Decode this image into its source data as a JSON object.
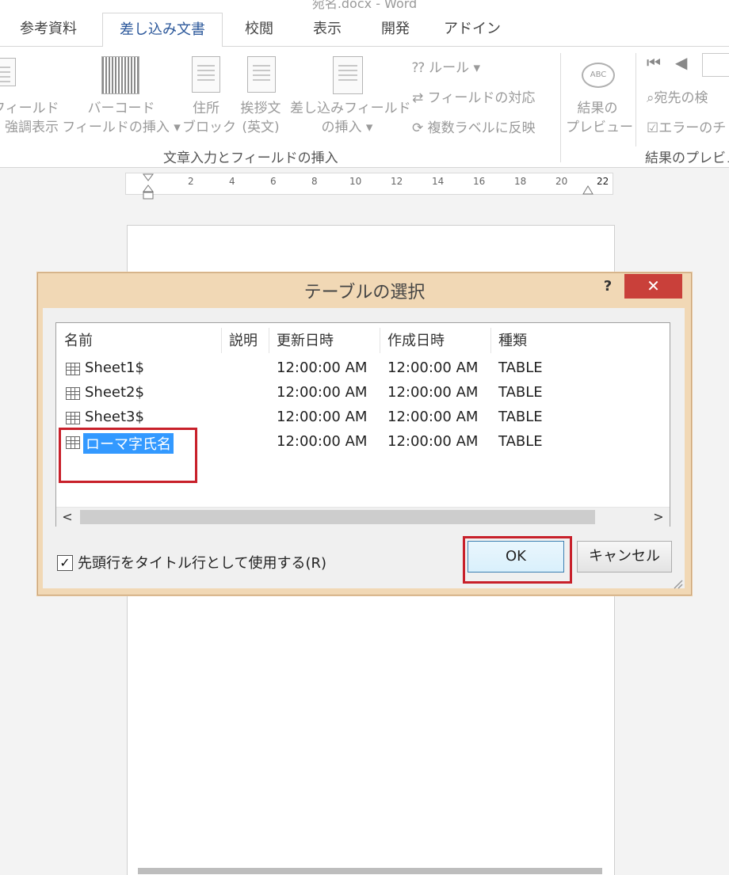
{
  "window": {
    "title": "宛名.docx - Word"
  },
  "tabs": [
    {
      "label": "参考資料"
    },
    {
      "label": "差し込み文書",
      "active": true
    },
    {
      "label": "校閲"
    },
    {
      "label": "表示"
    },
    {
      "label": "開発"
    },
    {
      "label": "アドイン"
    }
  ],
  "ribbon": {
    "field_highlight": [
      "フィールド",
      "強調表示"
    ],
    "barcode": [
      "バーコード",
      "フィールドの挿入"
    ],
    "address_block": [
      "住所",
      "ブロック"
    ],
    "greeting": [
      "挨拶文",
      "(英文)"
    ],
    "insert_merge_field": [
      "差し込みフィールド",
      "の挿入"
    ],
    "rules": "ルール",
    "match_fields": "フィールドの対応",
    "update_labels": "複数ラベルに反映",
    "group_write_insert": "文章入力とフィールドの挿入",
    "preview_results": [
      "結果の",
      "プレビュー"
    ],
    "find_recipient": "宛先の検",
    "check_errors": "エラーのチ",
    "group_preview": "結果のプレビュ"
  },
  "ruler": {
    "ticks": [
      "2",
      "4",
      "6",
      "8",
      "10",
      "12",
      "14",
      "16",
      "18",
      "20",
      "22"
    ]
  },
  "dialog": {
    "title": "テーブルの選択",
    "help_label": "?",
    "close_label": "✕",
    "columns": [
      "名前",
      "説明",
      "更新日時",
      "作成日時",
      "種類"
    ],
    "rows": [
      {
        "name": "Sheet1$",
        "description": "",
        "modified": "12:00:00 AM",
        "created": "12:00:00 AM",
        "type": "TABLE",
        "selected": false
      },
      {
        "name": "Sheet2$",
        "description": "",
        "modified": "12:00:00 AM",
        "created": "12:00:00 AM",
        "type": "TABLE",
        "selected": false
      },
      {
        "name": "Sheet3$",
        "description": "",
        "modified": "12:00:00 AM",
        "created": "12:00:00 AM",
        "type": "TABLE",
        "selected": false
      },
      {
        "name": "ローマ字氏名",
        "description": "",
        "modified": "12:00:00 AM",
        "created": "12:00:00 AM",
        "type": "TABLE",
        "selected": true
      }
    ],
    "scroll_left": "<",
    "scroll_right": ">",
    "first_row_header": {
      "label": "先頭行をタイトル行として使用する(R)",
      "checked": true
    },
    "ok_label": "OK",
    "cancel_label": "キャンセル"
  },
  "colors": {
    "selection": "#3399ff",
    "highlight_box": "#c8202a",
    "dialog_frame": "#f1d8b5",
    "close_button": "#c9403a"
  }
}
